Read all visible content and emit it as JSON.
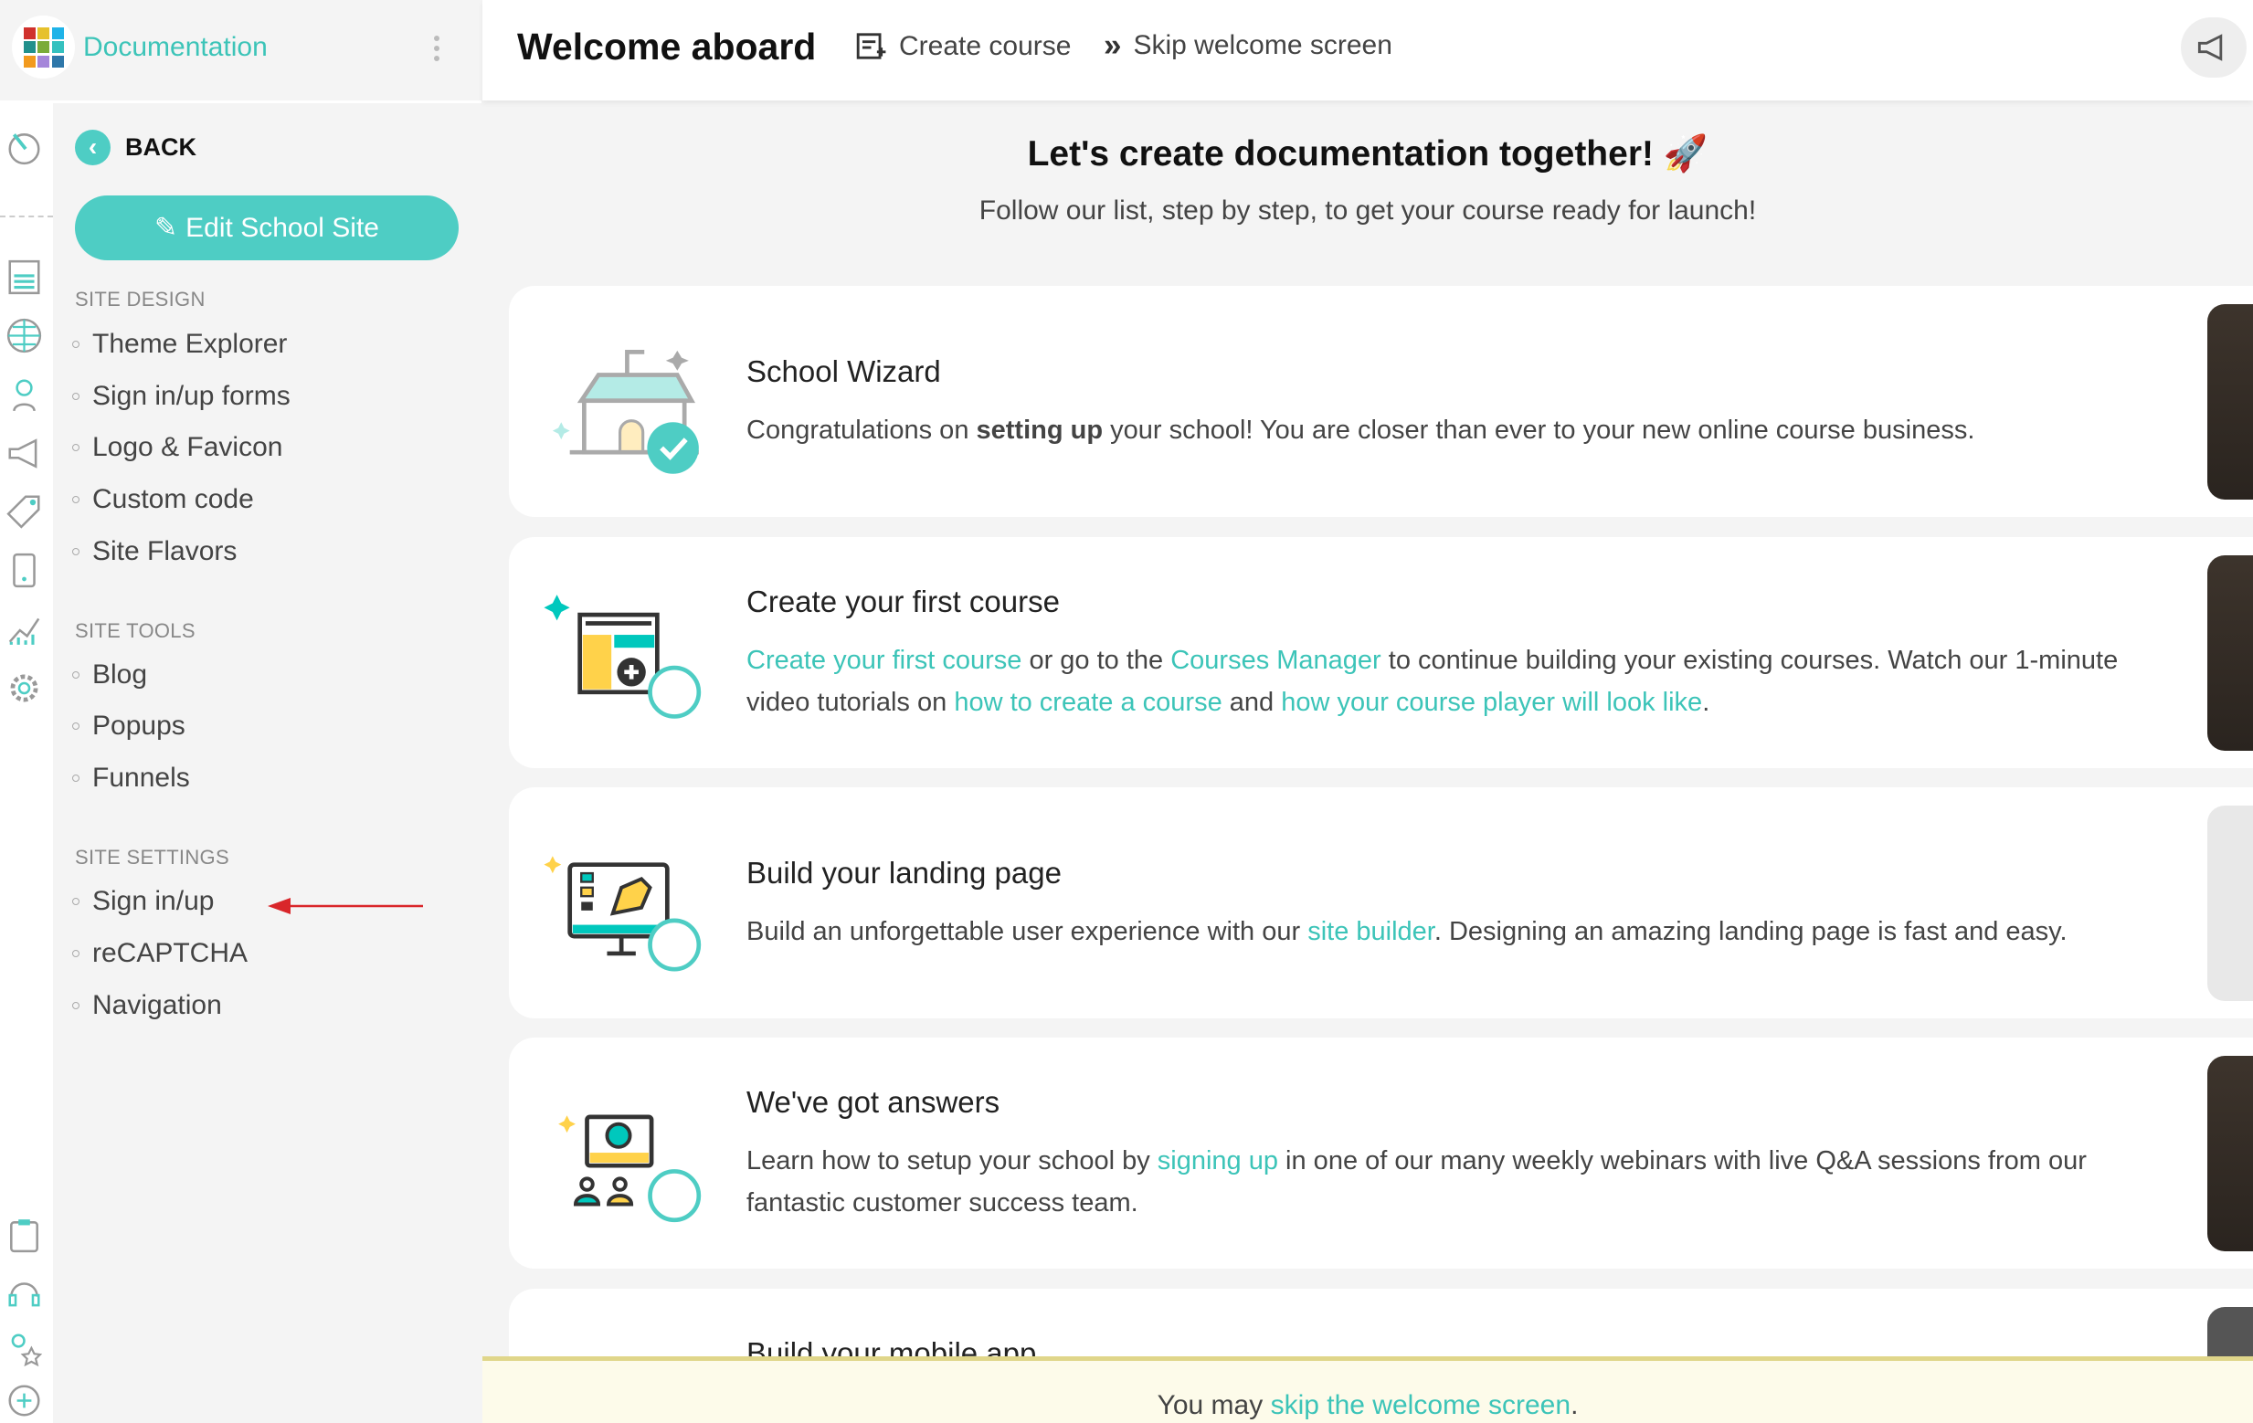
{
  "app": {
    "brand": "Documentation"
  },
  "colors": {
    "accent": "#4ecdc4",
    "banner_bg": "#fdfbea",
    "annotation_arrow": "#d9262a"
  },
  "sidebar": {
    "back_label": "BACK",
    "edit_button": "Edit School Site",
    "sections": [
      {
        "title": "SITE DESIGN",
        "items": [
          "Theme Explorer",
          "Sign in/up forms",
          "Logo & Favicon",
          "Custom code",
          "Site Flavors"
        ]
      },
      {
        "title": "SITE TOOLS",
        "items": [
          "Blog",
          "Popups",
          "Funnels"
        ]
      },
      {
        "title": "SITE SETTINGS",
        "items": [
          "Sign in/up",
          "reCAPTCHA",
          "Navigation"
        ]
      }
    ],
    "rail_icons": [
      "dashboard-gauge-icon",
      "pages-icon",
      "globe-icon",
      "users-icon",
      "megaphone-icon",
      "tag-icon",
      "mobile-icon",
      "analytics-icon",
      "settings-gear-icon",
      "clipboard-icon",
      "support-headset-icon",
      "affiliate-star-icon",
      "add-circle-icon"
    ]
  },
  "header": {
    "title": "Welcome aboard",
    "create_course": "Create course",
    "skip": "Skip welcome screen"
  },
  "hero": {
    "title": "Let's create documentation together! 🚀",
    "subtitle": "Follow our list, step by step, to get your course ready for launch!"
  },
  "cards": [
    {
      "title": "School Wizard",
      "desc": {
        "a": "Congratulations on ",
        "b": "setting up",
        "c": " your school! You are closer than ever to your new online course business."
      },
      "completed": true
    },
    {
      "title": "Create your first course",
      "desc": {
        "l1": "Create your first course",
        "t1": " or go to the ",
        "l2": "Courses Manager",
        "t2": " to continue building your existing courses. Watch our 1-minute video tutorials on ",
        "l3": "how to create a course",
        "t3": " and ",
        "l4": "how your course player will look like",
        "t4": "."
      },
      "completed": false
    },
    {
      "title": "Build your landing page",
      "desc": {
        "t1": "Build an unforgettable user experience with our ",
        "l1": "site builder",
        "t2": ". Designing an amazing landing page is fast and easy."
      },
      "completed": false
    },
    {
      "title": "We've got answers",
      "desc": {
        "t1": "Learn how to setup your school by ",
        "l1": "signing up",
        "t2": " in one of our many weekly webinars with live Q&A sessions from our fantastic customer success team."
      },
      "completed": false
    },
    {
      "title": "Build your mobile app"
    }
  ],
  "banner": {
    "prefix": "You may ",
    "link": "skip the welcome screen",
    "suffix": "."
  }
}
